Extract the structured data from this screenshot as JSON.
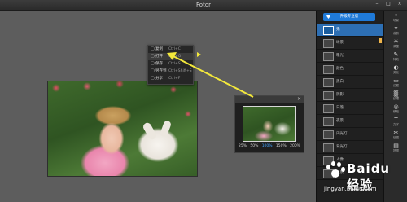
{
  "window": {
    "title": "Fotor",
    "controls": [
      "–",
      "□",
      "×"
    ]
  },
  "context_menu": {
    "items": [
      {
        "icon": "▢",
        "label": "复制",
        "shortcut": "Ctrl+C"
      },
      {
        "icon": "▢",
        "label": "打开",
        "shortcut": "Ctrl+O"
      },
      {
        "icon": "▢",
        "label": "保存",
        "shortcut": "Ctrl+S"
      },
      {
        "icon": "▢",
        "label": "另存到",
        "shortcut": "Ctrl+Shift+S"
      },
      {
        "icon": "▢",
        "label": "分享",
        "shortcut": "Ctrl+F"
      }
    ]
  },
  "navigator": {
    "zoom_options": [
      "25%",
      "50%",
      "100%",
      "150%",
      "200%"
    ],
    "active_zoom": "100%",
    "active_color": "#45a6ff"
  },
  "side_panel": {
    "upgrade_label": "升级专业版",
    "accent": "#2d6fb4",
    "items": [
      {
        "label": "无",
        "selected": true
      },
      {
        "label": "场景",
        "badge": true
      },
      {
        "label": "曝光"
      },
      {
        "label": "颜色"
      },
      {
        "label": "黑白"
      },
      {
        "label": "阴影"
      },
      {
        "label": "日落"
      },
      {
        "label": "夜景"
      },
      {
        "label": "闪光灯"
      },
      {
        "label": "背光灯"
      },
      {
        "label": "人像"
      },
      {
        "label": "风景"
      }
    ]
  },
  "toolbar": {
    "tools": [
      {
        "icon": "✦",
        "label": "场景",
        "icon_name": "scene-icon"
      },
      {
        "icon": "⌗",
        "label": "裁剪",
        "icon_name": "crop-icon"
      },
      {
        "icon": "☀",
        "label": "调整",
        "icon_name": "adjust-icon"
      },
      {
        "icon": "✎",
        "label": "特效",
        "icon_name": "effects-icon"
      },
      {
        "icon": "◐",
        "label": "美化",
        "icon_name": "beauty-icon"
      },
      {
        "icon": "▭",
        "label": "边框",
        "icon_name": "frame-icon"
      },
      {
        "icon": "▒",
        "label": "纹理",
        "icon_name": "texture-icon"
      },
      {
        "icon": "◎",
        "label": "移轴",
        "icon_name": "tiltshift-icon"
      },
      {
        "icon": "T",
        "label": "文字",
        "icon_name": "text-icon"
      },
      {
        "icon": "✂",
        "label": "贴图",
        "icon_name": "sticker-icon"
      },
      {
        "icon": "▤",
        "label": "拼图",
        "icon_name": "collage-icon"
      }
    ]
  },
  "watermark": {
    "brand": "Baidu 经验",
    "url": "jingyan.baidu.com"
  }
}
